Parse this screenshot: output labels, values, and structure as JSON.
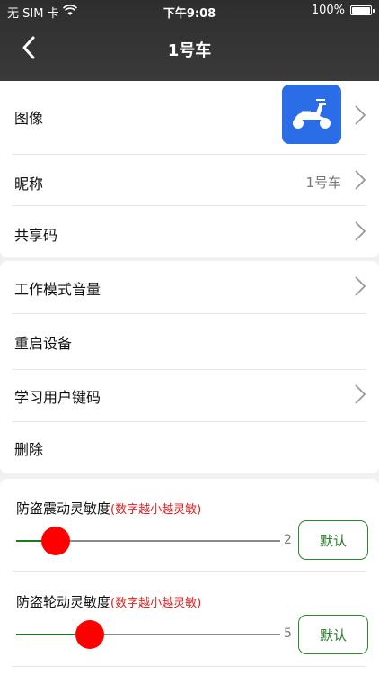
{
  "status_bar": {
    "carrier": "无 SIM 卡",
    "time": "下午9:08",
    "battery": "100%"
  },
  "nav": {
    "title": "1号车"
  },
  "device_card": {
    "image_label": "图像",
    "avatar_icon": "scooter-icon",
    "nickname_label": "昵称",
    "nickname_value": "1号车",
    "share_label": "共享码"
  },
  "settings_card": {
    "volume_label": "工作模式音量",
    "restart_label": "重启设备",
    "learn_label": "学习用户键码",
    "delete_label": "删除"
  },
  "sliders": [
    {
      "title": "防盗震动灵敏度",
      "hint": "(数字越小越灵敏)",
      "value": "2",
      "fraction": 0.15,
      "button": "默认"
    },
    {
      "title": "防盗轮动灵敏度",
      "hint": "(数字越小越灵敏)",
      "value": "5",
      "fraction": 0.28,
      "button": "默认"
    }
  ],
  "colors": {
    "accent_green": "#2a8a2a",
    "thumb_red": "#ff0000",
    "avatar_blue": "#2a6de6",
    "hint_red": "#e02020"
  }
}
